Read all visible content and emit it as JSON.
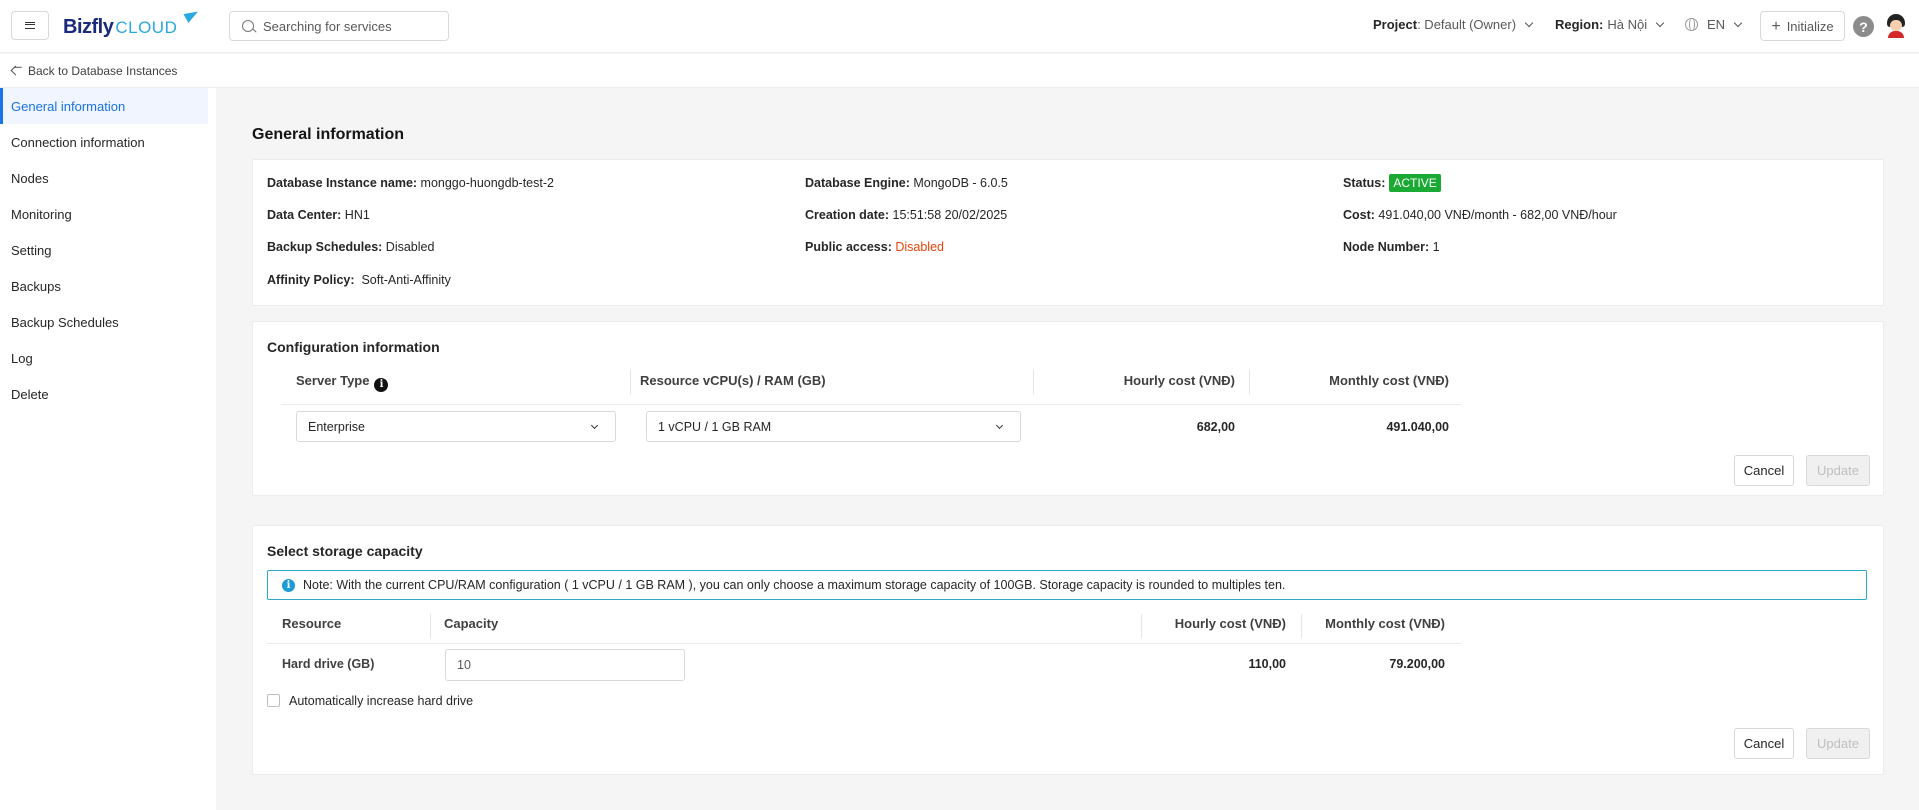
{
  "header": {
    "logo_main": "Bizfly",
    "logo_sub": "CLOUD",
    "search_placeholder": "Searching for services",
    "project_label": "Project",
    "project_value": ": Default (Owner)",
    "region_label": "Region:",
    "region_value": "Hà Nội",
    "language": "EN",
    "initialize_label": "Initialize",
    "help": "?"
  },
  "subbar": {
    "back_label": "Back to Database Instances"
  },
  "sidebar": {
    "items": [
      {
        "label": "General information"
      },
      {
        "label": "Connection information"
      },
      {
        "label": "Nodes"
      },
      {
        "label": "Monitoring"
      },
      {
        "label": "Setting"
      },
      {
        "label": "Backups"
      },
      {
        "label": "Backup Schedules"
      },
      {
        "label": "Log"
      },
      {
        "label": "Delete"
      }
    ]
  },
  "general": {
    "title": "General information",
    "instance_name_label": "Database Instance name:",
    "instance_name": " monggo-huongdb-test-2",
    "engine_label": "Database Engine:",
    "engine": " MongoDB - 6.0.5",
    "status_label": "Status:",
    "status": "ACTIVE",
    "datacenter_label": "Data Center:",
    "datacenter": " HN1",
    "creation_label": "Creation date:",
    "creation": " 15:51:58 20/02/2025",
    "cost_label": "Cost:",
    "cost": " 491.040,00 VNĐ/month - 682,00 VNĐ/hour",
    "backup_label": "Backup Schedules:",
    "backup": " Disabled",
    "public_label": "Public access:",
    "public": " Disabled",
    "node_label": "Node Number:",
    "node": " 1",
    "affinity_label": "Affinity Policy:",
    "affinity": "  Soft-Anti-Affinity",
    "status_color": "#1aaa33",
    "disabled_color": "#e8440a"
  },
  "configuration": {
    "title": "Configuration information",
    "headers": {
      "server_type": "Server Type",
      "resource": "Resource vCPU(s) / RAM (GB)",
      "hourly": "Hourly cost (VNĐ)",
      "monthly": "Monthly cost (VNĐ)"
    },
    "server_type_value": "Enterprise",
    "resource_value": "1 vCPU / 1 GB RAM",
    "hourly_value": "682,00",
    "monthly_value": "491.040,00",
    "cancel_label": "Cancel",
    "update_label": "Update"
  },
  "storage": {
    "title": "Select storage capacity",
    "note": "Note: With the current CPU/RAM configuration ( 1 vCPU / 1 GB RAM ), you can only choose a maximum storage capacity of 100GB. Storage capacity is rounded to multiples ten.",
    "headers": {
      "resource": "Resource",
      "capacity": "Capacity",
      "hourly": "Hourly cost (VNĐ)",
      "monthly": "Monthly cost (VNĐ)"
    },
    "row_label": "Hard drive (GB)",
    "capacity_value": "10",
    "hourly_value": "110,00",
    "monthly_value": "79.200,00",
    "auto_increase_label": "Automatically increase hard drive",
    "cancel_label": "Cancel",
    "update_label": "Update"
  }
}
